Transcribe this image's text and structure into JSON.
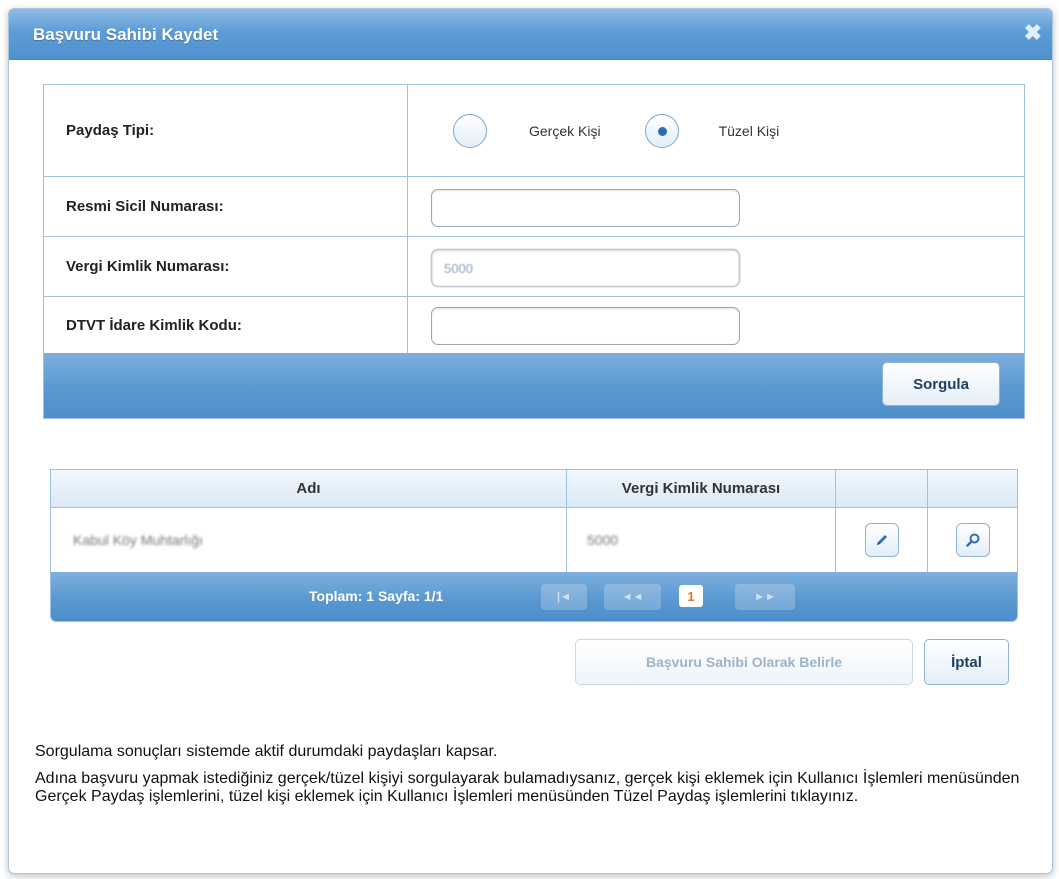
{
  "dialog": {
    "title": "Başvuru Sahibi Kaydet",
    "close_glyph": "✖"
  },
  "form": {
    "party_type_label": "Paydaş Tipi:",
    "party_type_options": [
      "Gerçek Kişi",
      "Tüzel Kişi"
    ],
    "party_type_selected": "Tüzel Kişi",
    "registry_label": "Resmi Sicil Numarası:",
    "registry_value": "",
    "tax_id_label": "Vergi Kimlik Numarası:",
    "tax_id_value": "5000",
    "dtvt_label": "DTVT İdare Kimlik Kodu:",
    "dtvt_value": "",
    "query_button": "Sorgula"
  },
  "grid": {
    "columns": [
      "Adı",
      "Vergi Kimlik Numarası",
      "",
      ""
    ],
    "rows": [
      {
        "name": "Kabul Köy Muhtarlığı",
        "tax_id": "5000"
      }
    ],
    "pager": {
      "summary": "Toplam: 1 Sayfa: 1/1",
      "first": "|◄",
      "prev": "◄◄",
      "current_page": "1",
      "next": "►►"
    }
  },
  "actions": {
    "set_applicant": "Başvuru Sahibi Olarak Belirle",
    "cancel": "İptal"
  },
  "notes": {
    "line1": "Sorgulama sonuçları sistemde aktif durumdaki paydaşları kapsar.",
    "line2": "Adına başvuru yapmak istediğiniz gerçek/tüzel kişiyi sorgulayarak bulamadıysanız, gerçek kişi eklemek için Kullanıcı İşlemleri menüsünden Gerçek Paydaş işlemlerini, tüzel kişi eklemek için Kullanıcı İşlemleri menüsünden Tüzel Paydaş işlemlerini tıklayınız."
  },
  "icons": [
    "close-icon",
    "edit-pencil-icon",
    "search-magnifier-icon"
  ],
  "colors": {
    "header_blue": "#5d9cd6",
    "border_blue": "#9ec2e4",
    "current_page": "#e0752a"
  }
}
